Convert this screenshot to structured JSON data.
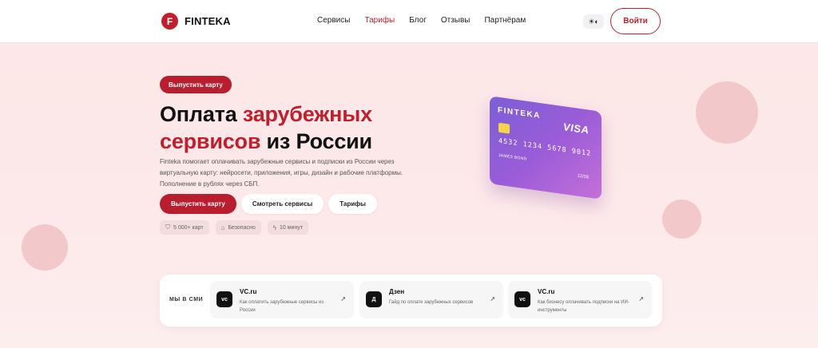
{
  "header": {
    "logo_mark": "F",
    "logo_text": "FINTEKA",
    "nav": [
      {
        "label": "Сервисы",
        "active": false
      },
      {
        "label": "Тарифы",
        "active": true
      },
      {
        "label": "Блог",
        "active": false
      },
      {
        "label": "Отзывы",
        "active": false
      },
      {
        "label": "Партнёрам",
        "active": false
      }
    ],
    "theme_toggle_icon": "sun-icon",
    "login_label": "Войти"
  },
  "hero": {
    "top_pill": "Выпустить карту",
    "title_line1_plain": "Оплата ",
    "title_line1_red": "зарубежных",
    "title_line2_red": "сервисов",
    "title_line2_plain": " из России",
    "description": "Finteka помогает оплачивать зарубежные сервисы и подписки из России через виртуальную карту: нейросети, приложения, игры, дизайн и рабочие платформы. Пополнение в рублях через СБП.",
    "buttons": [
      "Выпустить карту",
      "Смотреть сервисы",
      "Тарифы"
    ],
    "badges": [
      {
        "icon": "shield-icon",
        "glyph": "⛉",
        "label": "5 000+ карт"
      },
      {
        "icon": "lock-icon",
        "glyph": "⌂",
        "label": "Безопасно"
      },
      {
        "icon": "lightning-icon",
        "glyph": "ϟ",
        "label": "10 минут"
      }
    ]
  },
  "card": {
    "brand": "FINTEKA",
    "network": "VISA",
    "number": "4532 1234 5678 9012",
    "holder": "JAMES BOND",
    "expiry": "12/28"
  },
  "media": {
    "label": "МЫ В СМИ",
    "items": [
      {
        "logo": "vc",
        "title": "VC.ru",
        "desc": "Как оплатить зарубежные сервисы из России",
        "arrow": "↗"
      },
      {
        "logo": "Д",
        "title": "Дзен",
        "desc": "Гайд по оплате зарубежных сервисов",
        "arrow": "↗"
      },
      {
        "logo": "vc",
        "title": "VC.ru",
        "desc": "Как бизнесу оплачивать подписки на ИИ-инструменты",
        "arrow": "↗"
      }
    ]
  },
  "colors": {
    "accent": "#c0202e",
    "hero_bg": "#fde7e8",
    "card_gradient_start": "#7b5fd6",
    "card_gradient_end": "#c470d8"
  }
}
